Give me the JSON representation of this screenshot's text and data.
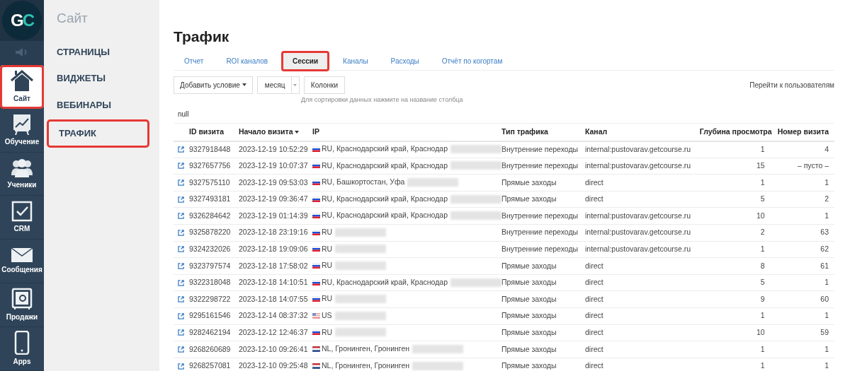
{
  "rail": {
    "logo": "GC",
    "items": [
      {
        "kind": "speaker",
        "selected": false,
        "highlighted": false
      },
      {
        "kind": "home",
        "label": "Сайт",
        "selected": true,
        "highlighted": true
      },
      {
        "kind": "chart",
        "label": "Обучение",
        "selected": false,
        "highlighted": false
      },
      {
        "kind": "users",
        "label": "Ученики",
        "selected": false,
        "highlighted": false
      },
      {
        "kind": "check",
        "label": "CRM",
        "selected": false,
        "highlighted": false
      },
      {
        "kind": "mail",
        "label": "Сообщения",
        "selected": false,
        "highlighted": false
      },
      {
        "kind": "safe",
        "label": "Продажи",
        "selected": false,
        "highlighted": false
      },
      {
        "kind": "phone",
        "label": "Apps",
        "selected": false,
        "highlighted": false
      }
    ]
  },
  "submenu": {
    "title": "Сайт",
    "items": [
      {
        "label": "СТРАНИЦЫ",
        "highlighted": false
      },
      {
        "label": "ВИДЖЕТЫ",
        "highlighted": false
      },
      {
        "label": "ВЕБИНАРЫ",
        "highlighted": false
      },
      {
        "label": "ТРАФИК",
        "highlighted": true
      }
    ]
  },
  "page_title": "Трафик",
  "tabs": [
    {
      "label": "Отчет",
      "selected": false,
      "highlighted": false
    },
    {
      "label": "ROI каналов",
      "selected": false,
      "highlighted": false
    },
    {
      "label": "Сессии",
      "selected": true,
      "highlighted": true
    },
    {
      "label": "Каналы",
      "selected": false,
      "highlighted": false
    },
    {
      "label": "Расходы",
      "selected": false,
      "highlighted": false
    },
    {
      "label": "Отчёт по когортам",
      "selected": false,
      "highlighted": false
    }
  ],
  "toolbar": {
    "add_condition": "Добавить условие",
    "period": "месяц",
    "columns": "Колонки",
    "hint": "Для сортировки данных нажмите на название столбца",
    "users_link": "Перейти к пользователям"
  },
  "filter_text": "null",
  "table": {
    "columns": [
      {
        "label": "ID визита",
        "sorted": false
      },
      {
        "label": "Начало визита",
        "sorted": true
      },
      {
        "label": "IP",
        "sorted": false
      },
      {
        "label": "Тип трафика",
        "sorted": false
      },
      {
        "label": "Канал",
        "sorted": false
      },
      {
        "label": "Глубина просмотра",
        "sorted": false
      },
      {
        "label": "Номер визита",
        "sorted": false
      }
    ],
    "rows": [
      {
        "id": "9327918448",
        "start": "2023-12-19 10:52:29",
        "kind": "ru",
        "ip": "RU, Краснодарский край, Краснодар",
        "type": "Внутренние переходы",
        "channel": "internal:pustovarav.getcourse.ru",
        "depth": "1",
        "number": "4"
      },
      {
        "id": "9327657756",
        "start": "2023-12-19 10:07:37",
        "kind": "ru",
        "ip": "RU, Краснодарский край, Краснодар",
        "type": "Внутренние переходы",
        "channel": "internal:pustovarav.getcourse.ru",
        "depth": "15",
        "number": "– пусто –"
      },
      {
        "id": "9327575110",
        "start": "2023-12-19 09:53:03",
        "kind": "ru",
        "ip": "RU, Башкортостан, Уфа",
        "type": "Прямые заходы",
        "channel": "direct",
        "depth": "1",
        "number": "1"
      },
      {
        "id": "9327493181",
        "start": "2023-12-19 09:36:47",
        "kind": "ru",
        "ip": "RU, Краснодарский край, Краснодар",
        "type": "Прямые заходы",
        "channel": "direct",
        "depth": "5",
        "number": "2"
      },
      {
        "id": "9326284642",
        "start": "2023-12-19 01:14:39",
        "kind": "ru",
        "ip": "RU, Краснодарский край, Краснодар",
        "type": "Внутренние переходы",
        "channel": "internal:pustovarav.getcourse.ru",
        "depth": "10",
        "number": "1"
      },
      {
        "id": "9325878220",
        "start": "2023-12-18 23:19:16",
        "kind": "ru",
        "ip": "RU",
        "type": "Внутренние переходы",
        "channel": "internal:pustovarav.getcourse.ru",
        "depth": "2",
        "number": "63"
      },
      {
        "id": "9324232026",
        "start": "2023-12-18 19:09:06",
        "kind": "ru",
        "ip": "RU",
        "type": "Внутренние переходы",
        "channel": "internal:pustovarav.getcourse.ru",
        "depth": "1",
        "number": "62"
      },
      {
        "id": "9323797574",
        "start": "2023-12-18 17:58:02",
        "kind": "ru",
        "ip": "RU",
        "type": "Прямые заходы",
        "channel": "direct",
        "depth": "8",
        "number": "61"
      },
      {
        "id": "9322318048",
        "start": "2023-12-18 14:10:51",
        "kind": "ru",
        "ip": "RU, Краснодарский край, Краснодар",
        "type": "Прямые заходы",
        "channel": "direct",
        "depth": "5",
        "number": "1"
      },
      {
        "id": "9322298722",
        "start": "2023-12-18 14:07:55",
        "kind": "ru",
        "ip": "RU",
        "type": "Прямые заходы",
        "channel": "direct",
        "depth": "9",
        "number": "60"
      },
      {
        "id": "9295161546",
        "start": "2023-12-14 08:37:32",
        "kind": "us",
        "ip": "US",
        "type": "Прямые заходы",
        "channel": "direct",
        "depth": "1",
        "number": "1"
      },
      {
        "id": "9282462194",
        "start": "2023-12-12 12:46:37",
        "kind": "ru",
        "ip": "RU",
        "type": "Прямые заходы",
        "channel": "direct",
        "depth": "10",
        "number": "59"
      },
      {
        "id": "9268260689",
        "start": "2023-12-10 09:26:41",
        "kind": "nl",
        "ip": "NL, Гронинген, Гронинген",
        "type": "Прямые заходы",
        "channel": "direct",
        "depth": "1",
        "number": "1"
      },
      {
        "id": "9268257081",
        "start": "2023-12-10 09:25:48",
        "kind": "nl",
        "ip": "NL, Гронинген, Гронинген",
        "type": "Прямые заходы",
        "channel": "direct",
        "depth": "1",
        "number": "1"
      }
    ]
  }
}
